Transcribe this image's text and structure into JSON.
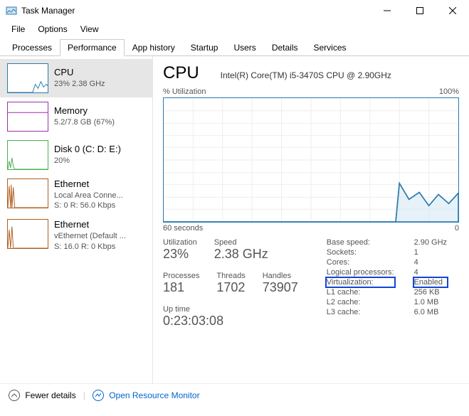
{
  "window": {
    "title": "Task Manager"
  },
  "menu": {
    "file": "File",
    "options": "Options",
    "view": "View"
  },
  "tabs": {
    "processes": "Processes",
    "performance": "Performance",
    "apphistory": "App history",
    "startup": "Startup",
    "users": "Users",
    "details": "Details",
    "services": "Services"
  },
  "sidebar": {
    "cpu": {
      "name": "CPU",
      "sub1": "23%  2.38 GHz"
    },
    "memory": {
      "name": "Memory",
      "sub1": "5.2/7.8 GB (67%)"
    },
    "disk": {
      "name": "Disk 0 (C: D: E:)",
      "sub1": "20%"
    },
    "eth0": {
      "name": "Ethernet",
      "sub1": "Local Area Conne...",
      "sub2": "S: 0 R: 56.0 Kbps"
    },
    "eth1": {
      "name": "Ethernet",
      "sub1": "vEthernet (Default ...",
      "sub2": "S: 16.0 R: 0 Kbps"
    }
  },
  "main": {
    "title": "CPU",
    "model": "Intel(R) Core(TM) i5-3470S CPU @ 2.90GHz",
    "ylabel": "% Utilization",
    "ymax": "100%",
    "xleft": "60 seconds",
    "xright": "0",
    "stats": {
      "utilization_label": "Utilization",
      "utilization": "23%",
      "speed_label": "Speed",
      "speed": "2.38 GHz",
      "processes_label": "Processes",
      "processes": "181",
      "threads_label": "Threads",
      "threads": "1702",
      "handles_label": "Handles",
      "handles": "73907",
      "uptime_label": "Up time",
      "uptime": "0:23:03:08"
    },
    "right": {
      "base_speed_label": "Base speed:",
      "base_speed": "2.90 GHz",
      "sockets_label": "Sockets:",
      "sockets": "1",
      "cores_label": "Cores:",
      "cores": "4",
      "logical_label": "Logical processors:",
      "logical": "4",
      "virt_label": "Virtualization:",
      "virt": "Enabled",
      "l1_label": "L1 cache:",
      "l1": "256 KB",
      "l2_label": "L2 cache:",
      "l2": "1.0 MB",
      "l3_label": "L3 cache:",
      "l3": "6.0 MB"
    }
  },
  "footer": {
    "fewer": "Fewer details",
    "monitor": "Open Resource Monitor"
  },
  "colors": {
    "cpu": "#2a7ab0",
    "memory": "#9b2fae",
    "disk": "#4caf50",
    "eth": "#b05e1f"
  },
  "chart_data": {
    "type": "line",
    "title": "% Utilization",
    "xlabel": "seconds",
    "ylabel": "% Utilization",
    "xlim": [
      60,
      0
    ],
    "ylim": [
      0,
      100
    ],
    "x": [
      60,
      55,
      50,
      45,
      40,
      35,
      30,
      25,
      20,
      15,
      12,
      10,
      8,
      6,
      4,
      2,
      0
    ],
    "values": [
      0,
      0,
      0,
      0,
      0,
      0,
      0,
      0,
      0,
      0,
      31,
      18,
      24,
      13,
      22,
      15,
      23
    ]
  }
}
